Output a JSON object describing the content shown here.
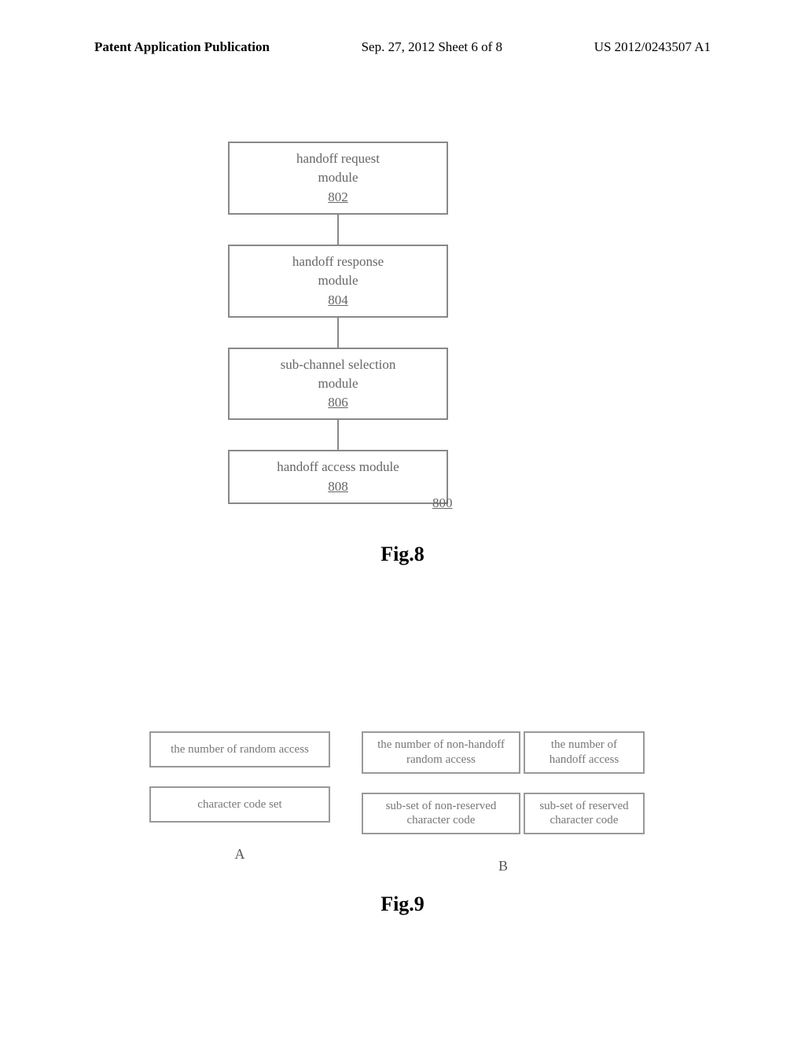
{
  "header": {
    "left": "Patent Application Publication",
    "center": "Sep. 27, 2012  Sheet 6 of 8",
    "right": "US 2012/0243507 A1"
  },
  "fig8": {
    "modules": [
      {
        "line1": "handoff request",
        "line2": "module",
        "num": "802"
      },
      {
        "line1": "handoff response",
        "line2": "module",
        "num": "804"
      },
      {
        "line1": "sub-channel selection",
        "line2": "module",
        "num": "806"
      },
      {
        "line1": "handoff access module",
        "line2": "",
        "num": "808"
      }
    ],
    "figure_num": "800",
    "caption": "Fig.8"
  },
  "fig9": {
    "col_a": {
      "box1": "the number of random access",
      "box2": "character code set",
      "label": "A"
    },
    "col_b": {
      "row1_left": "the number of non-handoff random access",
      "row1_right": "the number of handoff access",
      "row2_left": "sub-set of non-reserved character code",
      "row2_right": "sub-set of reserved character code",
      "label": "B"
    },
    "caption": "Fig.9"
  }
}
